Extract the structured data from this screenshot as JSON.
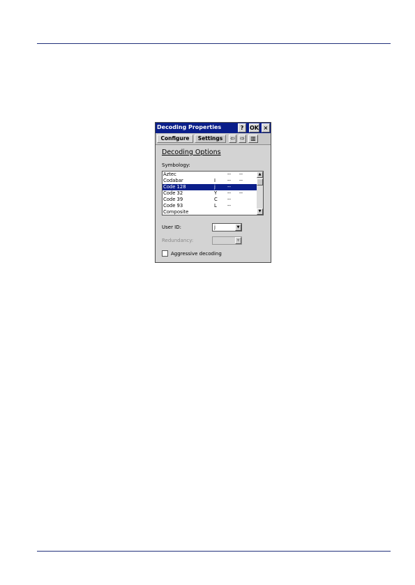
{
  "dialog": {
    "title": "Decoding Properties",
    "help_label": "?",
    "ok_label": "OK",
    "close_label": "×"
  },
  "tabs": [
    {
      "label": "Configure"
    },
    {
      "label": "Settings"
    }
  ],
  "nav": {
    "prev_glyph": "⇦",
    "next_glyph": "⇨",
    "barcode_glyph": "▥"
  },
  "panel": {
    "section_title": "Decoding Options",
    "symbology_label": "Symbology:",
    "symbologies": [
      {
        "name": "Aztec",
        "f1": "",
        "f2": "--",
        "f3": "--"
      },
      {
        "name": "Codabar",
        "f1": "I",
        "f2": "--",
        "f3": "--"
      },
      {
        "name": "Code 128",
        "f1": "j",
        "f2": "--",
        "f3": ""
      },
      {
        "name": "Code 32",
        "f1": "Y",
        "f2": "--",
        "f3": "--"
      },
      {
        "name": "Code 39",
        "f1": "C",
        "f2": "--",
        "f3": ""
      },
      {
        "name": "Code 93",
        "f1": "L",
        "f2": "--",
        "f3": ""
      },
      {
        "name": "Composite",
        "f1": "",
        "f2": "",
        "f3": ""
      }
    ],
    "selected_index": 2,
    "user_id_label": "User ID:",
    "user_id_value": "j",
    "redundancy_label": "Redundancy:",
    "redundancy_value": "",
    "aggressive_label": "Aggressive decoding",
    "aggressive_checked": false,
    "scroll_up_glyph": "▲",
    "scroll_down_glyph": "▼",
    "dropdown_glyph": "▼"
  },
  "colors": {
    "titlebar": "#0a1e8a",
    "selection": "#0a1e8a",
    "rule": "#1f2f7a"
  }
}
